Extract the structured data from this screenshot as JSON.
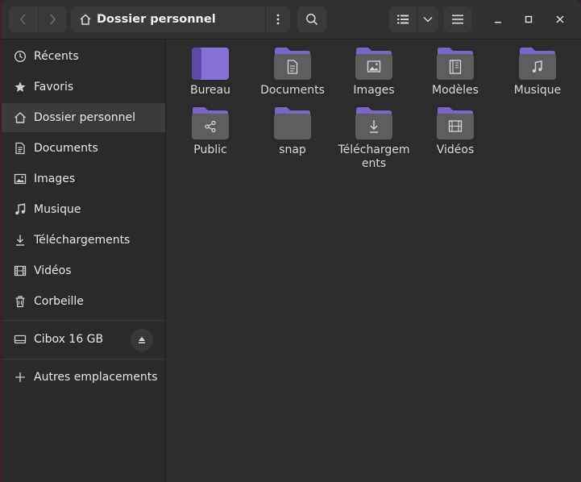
{
  "path": {
    "current": "Dossier personnel"
  },
  "sidebar": {
    "items": [
      {
        "label": "Récents",
        "icon": "clock-icon"
      },
      {
        "label": "Favoris",
        "icon": "star-icon"
      },
      {
        "label": "Dossier personnel",
        "icon": "home-icon",
        "active": true
      },
      {
        "label": "Documents",
        "icon": "document-icon"
      },
      {
        "label": "Images",
        "icon": "image-icon"
      },
      {
        "label": "Musique",
        "icon": "music-icon"
      },
      {
        "label": "Téléchargements",
        "icon": "download-icon"
      },
      {
        "label": "Vidéos",
        "icon": "film-icon"
      },
      {
        "label": "Corbeille",
        "icon": "trash-icon"
      }
    ],
    "device": {
      "label": "Cibox 16 GB",
      "icon": "drive-icon"
    },
    "other": {
      "label": "Autres emplacements",
      "icon": "plus-icon"
    }
  },
  "files": [
    {
      "label": "Bureau",
      "icon": "desktop-folder-icon"
    },
    {
      "label": "Documents",
      "icon": "documents-folder-icon"
    },
    {
      "label": "Images",
      "icon": "images-folder-icon"
    },
    {
      "label": "Modèles",
      "icon": "templates-folder-icon"
    },
    {
      "label": "Musique",
      "icon": "music-folder-icon"
    },
    {
      "label": "Public",
      "icon": "public-folder-icon"
    },
    {
      "label": "snap",
      "icon": "folder-icon"
    },
    {
      "label": "Télécharge​ments",
      "icon": "downloads-folder-icon"
    },
    {
      "label": "Vidéos",
      "icon": "videos-folder-icon"
    }
  ],
  "colors": {
    "accent": "#7a63c9",
    "folder_body": "#5e5e5e"
  }
}
